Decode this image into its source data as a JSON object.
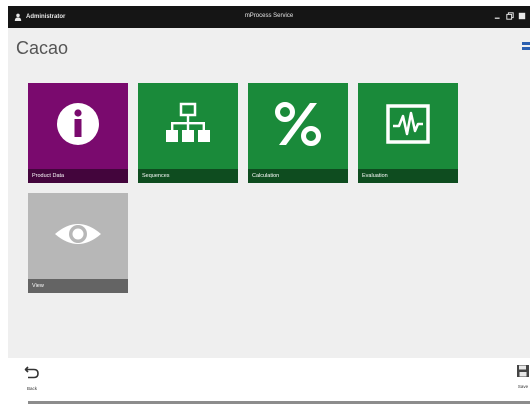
{
  "titlebar": {
    "user": "Administrator",
    "app_title": "mProcess Service"
  },
  "page": {
    "title": "Cacao"
  },
  "tiles": [
    {
      "label": "Product Data",
      "icon": "info-icon",
      "color": "#7a0a6e"
    },
    {
      "label": "Sequences",
      "icon": "sitemap-icon",
      "color": "#1a8a3a"
    },
    {
      "label": "Calculation",
      "icon": "percent-icon",
      "color": "#1a8a3a"
    },
    {
      "label": "Evaluation",
      "icon": "waveform-icon",
      "color": "#1a8a3a"
    },
    {
      "label": "View",
      "icon": "eye-icon",
      "color": "#b7b7b7"
    }
  ],
  "bottombar": {
    "back_label": "Back",
    "save_label": "Save"
  }
}
